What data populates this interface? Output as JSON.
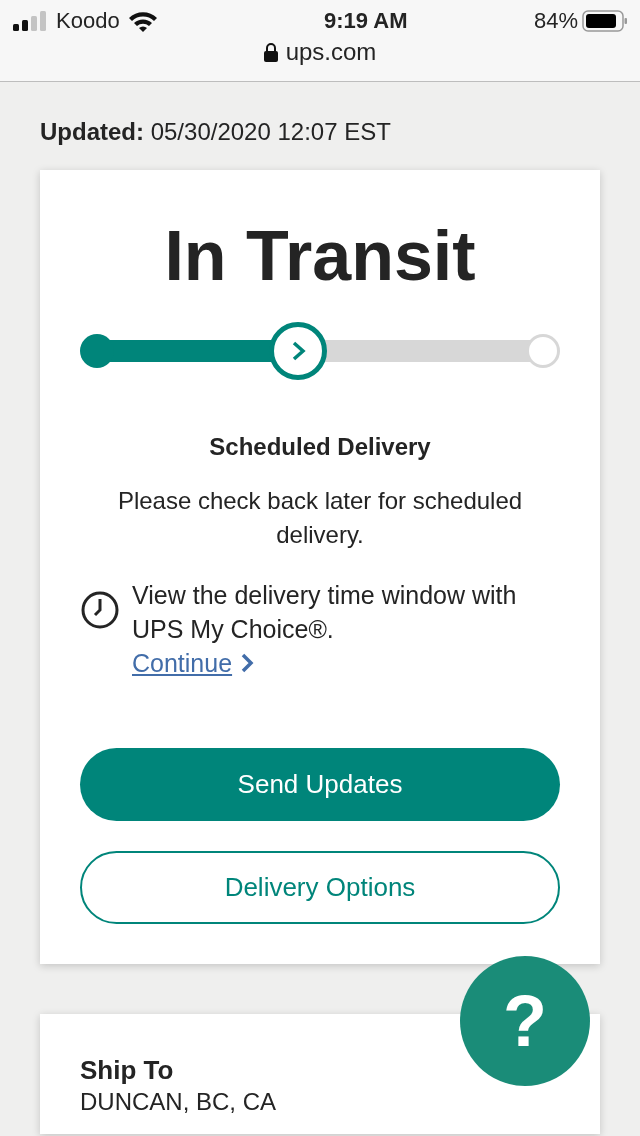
{
  "status_bar": {
    "carrier": "Koodo",
    "time": "9:19 AM",
    "battery": "84%",
    "url": "ups.com"
  },
  "updated": {
    "label": "Updated:",
    "value": "05/30/2020 12:07 EST"
  },
  "tracking": {
    "status": "In Transit",
    "progress": {
      "level": 0.45,
      "steps": [
        {
          "kind": "done"
        },
        {
          "kind": "current"
        },
        {
          "kind": "pending"
        }
      ]
    },
    "heading": "Scheduled Delivery",
    "message": "Please check back later for scheduled delivery.",
    "notice": "View the delivery time window with UPS My Choice®.",
    "link": "Continue",
    "buttons": [
      {
        "label": "Send Updates",
        "kind": "primary"
      },
      {
        "label": "Delivery Options",
        "kind": "secondary"
      }
    ]
  },
  "help": {
    "label": "?"
  },
  "ship_to": {
    "heading": "Ship To",
    "address": "DUNCAN, BC, CA"
  }
}
